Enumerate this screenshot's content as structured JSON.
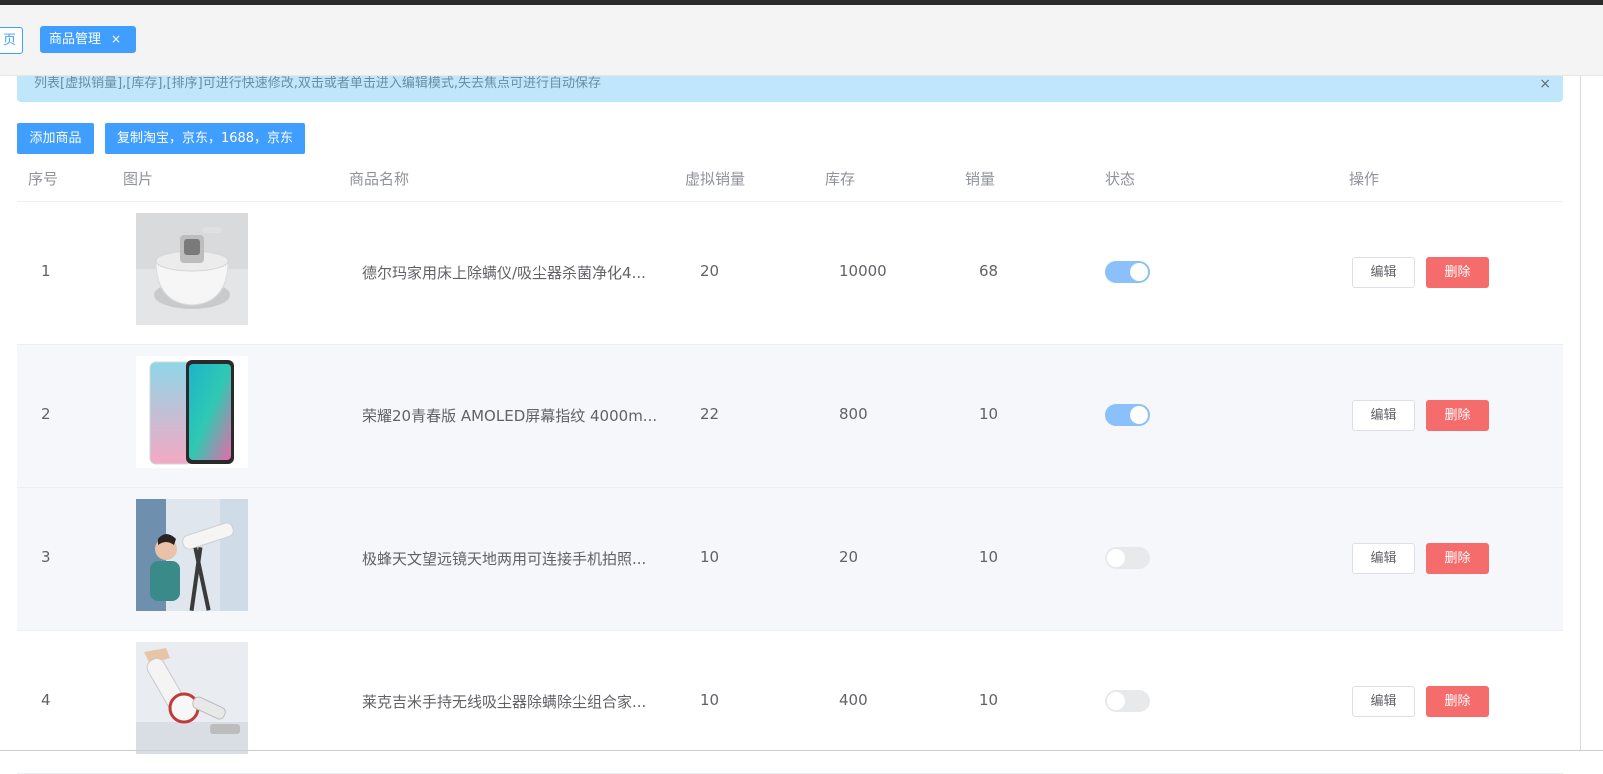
{
  "tags": {
    "home_label": "页",
    "active_label": "商品管理",
    "active_close": "×"
  },
  "alert": {
    "text": "列表[虚拟销量],[库存],[排序]可进行快速修改,双击或者单击进入编辑模式,失去焦点可进行自动保存",
    "close": "×"
  },
  "toolbar": {
    "add_label": "添加商品",
    "copy_label": "复制淘宝，京东，1688，京东"
  },
  "table": {
    "headers": [
      "序号",
      "图片",
      "商品名称",
      "虚拟销量",
      "库存",
      "销量",
      "状态",
      "操作"
    ],
    "rows": [
      {
        "index": "1",
        "name": "德尔玛家用床上除螨仪/吸尘器杀菌净化4...",
        "virtual_sales": "20",
        "stock": "10000",
        "sales": "68",
        "status_on": true,
        "edit": "编辑",
        "delete": "删除"
      },
      {
        "index": "2",
        "name": "荣耀20青春版 AMOLED屏幕指纹 4000m...",
        "virtual_sales": "22",
        "stock": "800",
        "sales": "10",
        "status_on": true,
        "edit": "编辑",
        "delete": "删除"
      },
      {
        "index": "3",
        "name": "极蜂天文望远镜天地两用可连接手机拍照...",
        "virtual_sales": "10",
        "stock": "20",
        "sales": "10",
        "status_on": false,
        "edit": "编辑",
        "delete": "删除"
      },
      {
        "index": "4",
        "name": "莱克吉米手持无线吸尘器除螨除尘组合家...",
        "virtual_sales": "10",
        "stock": "400",
        "sales": "10",
        "status_on": false,
        "edit": "编辑",
        "delete": "删除"
      }
    ]
  },
  "colors": {
    "primary": "#409eff",
    "danger": "#f56c6c",
    "alert_bg": "#bfe6fb",
    "switch_on": "#8ac0fb"
  }
}
